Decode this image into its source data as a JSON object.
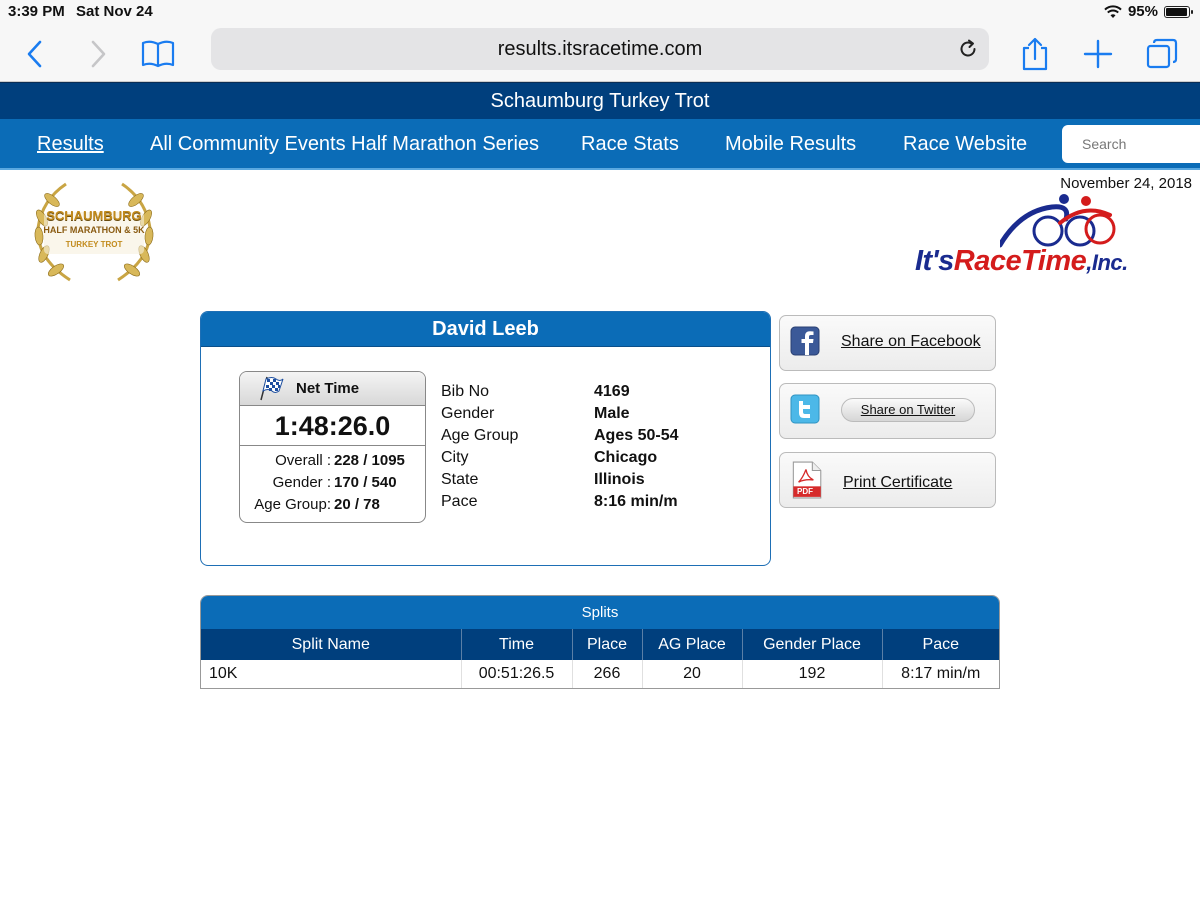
{
  "status_bar": {
    "time": "3:39 PM",
    "date": "Sat Nov 24",
    "battery": "95%",
    "battery_level": 0.95
  },
  "browser": {
    "url": "results.itsracetime.com"
  },
  "site": {
    "title": "Schaumburg Turkey Trot"
  },
  "nav": {
    "items": [
      {
        "label": "Results",
        "active": true
      },
      {
        "label": "All Community Events Half Marathon Series"
      },
      {
        "label": "Race Stats"
      },
      {
        "label": "Mobile Results"
      },
      {
        "label": "Race Website"
      }
    ],
    "search_placeholder": "Search"
  },
  "race_date": "November 24, 2018",
  "event_logo": {
    "line1": "SCHAUMBURG",
    "line2": "HALF MARATHON & 5K",
    "line3": "TURKEY TROT"
  },
  "company_logo": {
    "part1": "It's",
    "part2": "RaceTime",
    "part3": ",Inc."
  },
  "runner": {
    "name": "David Leeb",
    "net_time_label": "Net Time",
    "net_time": "1:48:26.0",
    "ranks": [
      {
        "label": "Overall :",
        "value": "228 / 1095"
      },
      {
        "label": "Gender :",
        "value": "170 / 540"
      },
      {
        "label": "Age Group:",
        "value": "20 / 78"
      }
    ],
    "details": [
      {
        "label": "Bib No",
        "value": "4169"
      },
      {
        "label": "Gender",
        "value": "Male"
      },
      {
        "label": "Age Group",
        "value": "Ages 50-54"
      },
      {
        "label": "City",
        "value": "Chicago"
      },
      {
        "label": "State",
        "value": "Illinois"
      },
      {
        "label": "Pace",
        "value": "8:16 min/m"
      }
    ]
  },
  "share": {
    "facebook": "Share on Facebook",
    "twitter": "Share on Twitter",
    "certificate": "Print Certificate",
    "pdf_badge": "PDF"
  },
  "splits": {
    "title": "Splits",
    "columns": [
      "Split Name",
      "Time",
      "Place",
      "AG Place",
      "Gender Place",
      "Pace"
    ],
    "rows": [
      [
        "10K",
        "00:51:26.5",
        "266",
        "20",
        "192",
        "8:17 min/m"
      ]
    ]
  },
  "colors": {
    "header_dark": "#003f7d",
    "nav_blue": "#0b6cb7",
    "ios_blue": "#1a7cf0"
  }
}
